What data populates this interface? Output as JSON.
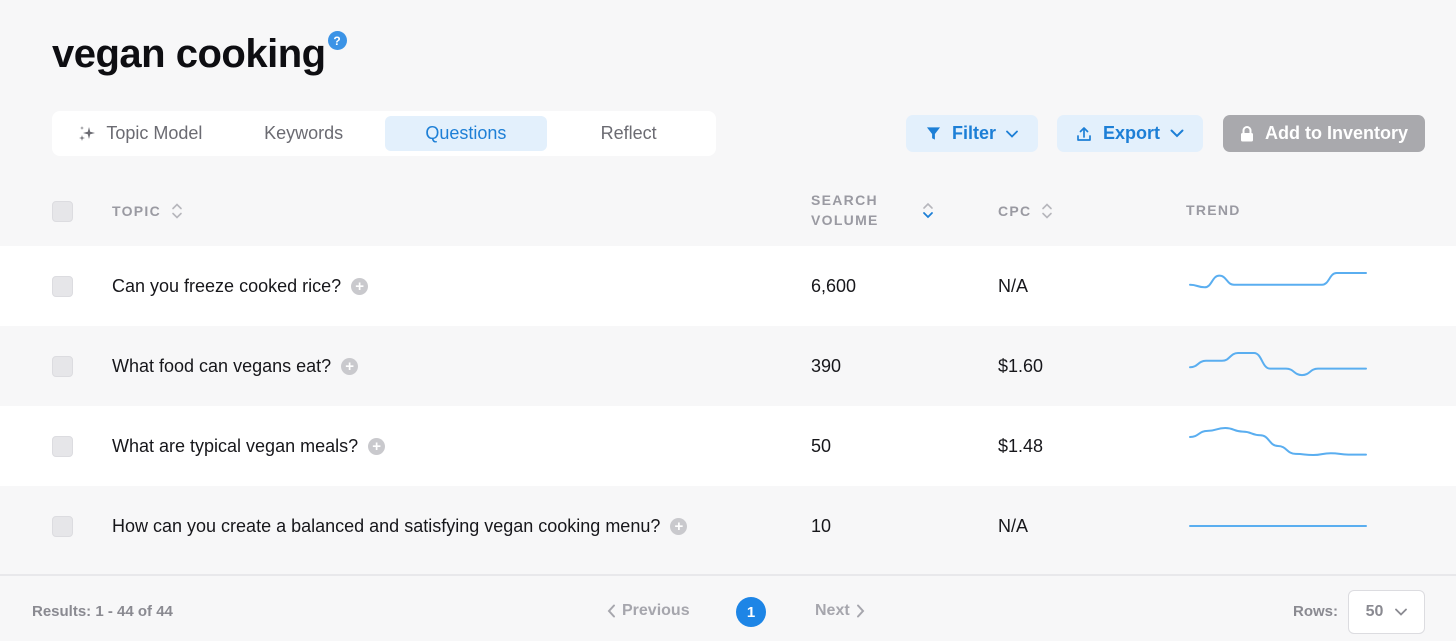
{
  "page": {
    "title": "vegan cooking",
    "help_glyph": "?"
  },
  "tabs": [
    {
      "label": "Topic Model",
      "icon": "sparkle-icon"
    },
    {
      "label": "Keywords"
    },
    {
      "label": "Questions",
      "active": true
    },
    {
      "label": "Reflect"
    }
  ],
  "toolbar": {
    "filter_label": "Filter",
    "export_label": "Export",
    "inventory_label": "Add to Inventory"
  },
  "table": {
    "headers": {
      "topic": "TOPIC",
      "volume_line1": "SEARCH",
      "volume_line2": "VOLUME",
      "cpc": "CPC",
      "trend": "TREND"
    },
    "rows": [
      {
        "topic": "Can you freeze cooked rice?",
        "volume": "6,600",
        "cpc": "N/A",
        "trend": [
          0.45,
          0.55,
          0.1,
          0.45,
          0.45,
          0.45,
          0.45,
          0.45,
          0.45,
          0.45,
          0.0,
          0.0,
          0.0
        ]
      },
      {
        "topic": "What food can vegans eat?",
        "volume": "390",
        "cpc": "$1.60",
        "trend": [
          0.55,
          0.3,
          0.3,
          0.0,
          0.0,
          0.6,
          0.6,
          0.85,
          0.6,
          0.6,
          0.6,
          0.6
        ]
      },
      {
        "topic": "What are typical vegan meals?",
        "volume": "50",
        "cpc": "$1.48",
        "trend": [
          0.25,
          0.08,
          0.0,
          0.1,
          0.2,
          0.5,
          0.72,
          0.75,
          0.7,
          0.74,
          0.74
        ]
      },
      {
        "topic": "How can you create a balanced and satisfying vegan cooking menu?",
        "volume": "10",
        "cpc": "N/A",
        "trend": [
          0.5,
          0.5,
          0.5,
          0.5,
          0.5,
          0.5,
          0.5,
          0.5,
          0.5,
          0.5,
          0.5
        ]
      }
    ]
  },
  "footer": {
    "results": "Results: 1 - 44 of 44",
    "previous_label": "Previous",
    "next_label": "Next",
    "current_page": "1",
    "rows_label": "Rows:",
    "rows_value": "50"
  },
  "colors": {
    "accent": "#1d7fd6",
    "trend_line": "#5aaef0"
  }
}
